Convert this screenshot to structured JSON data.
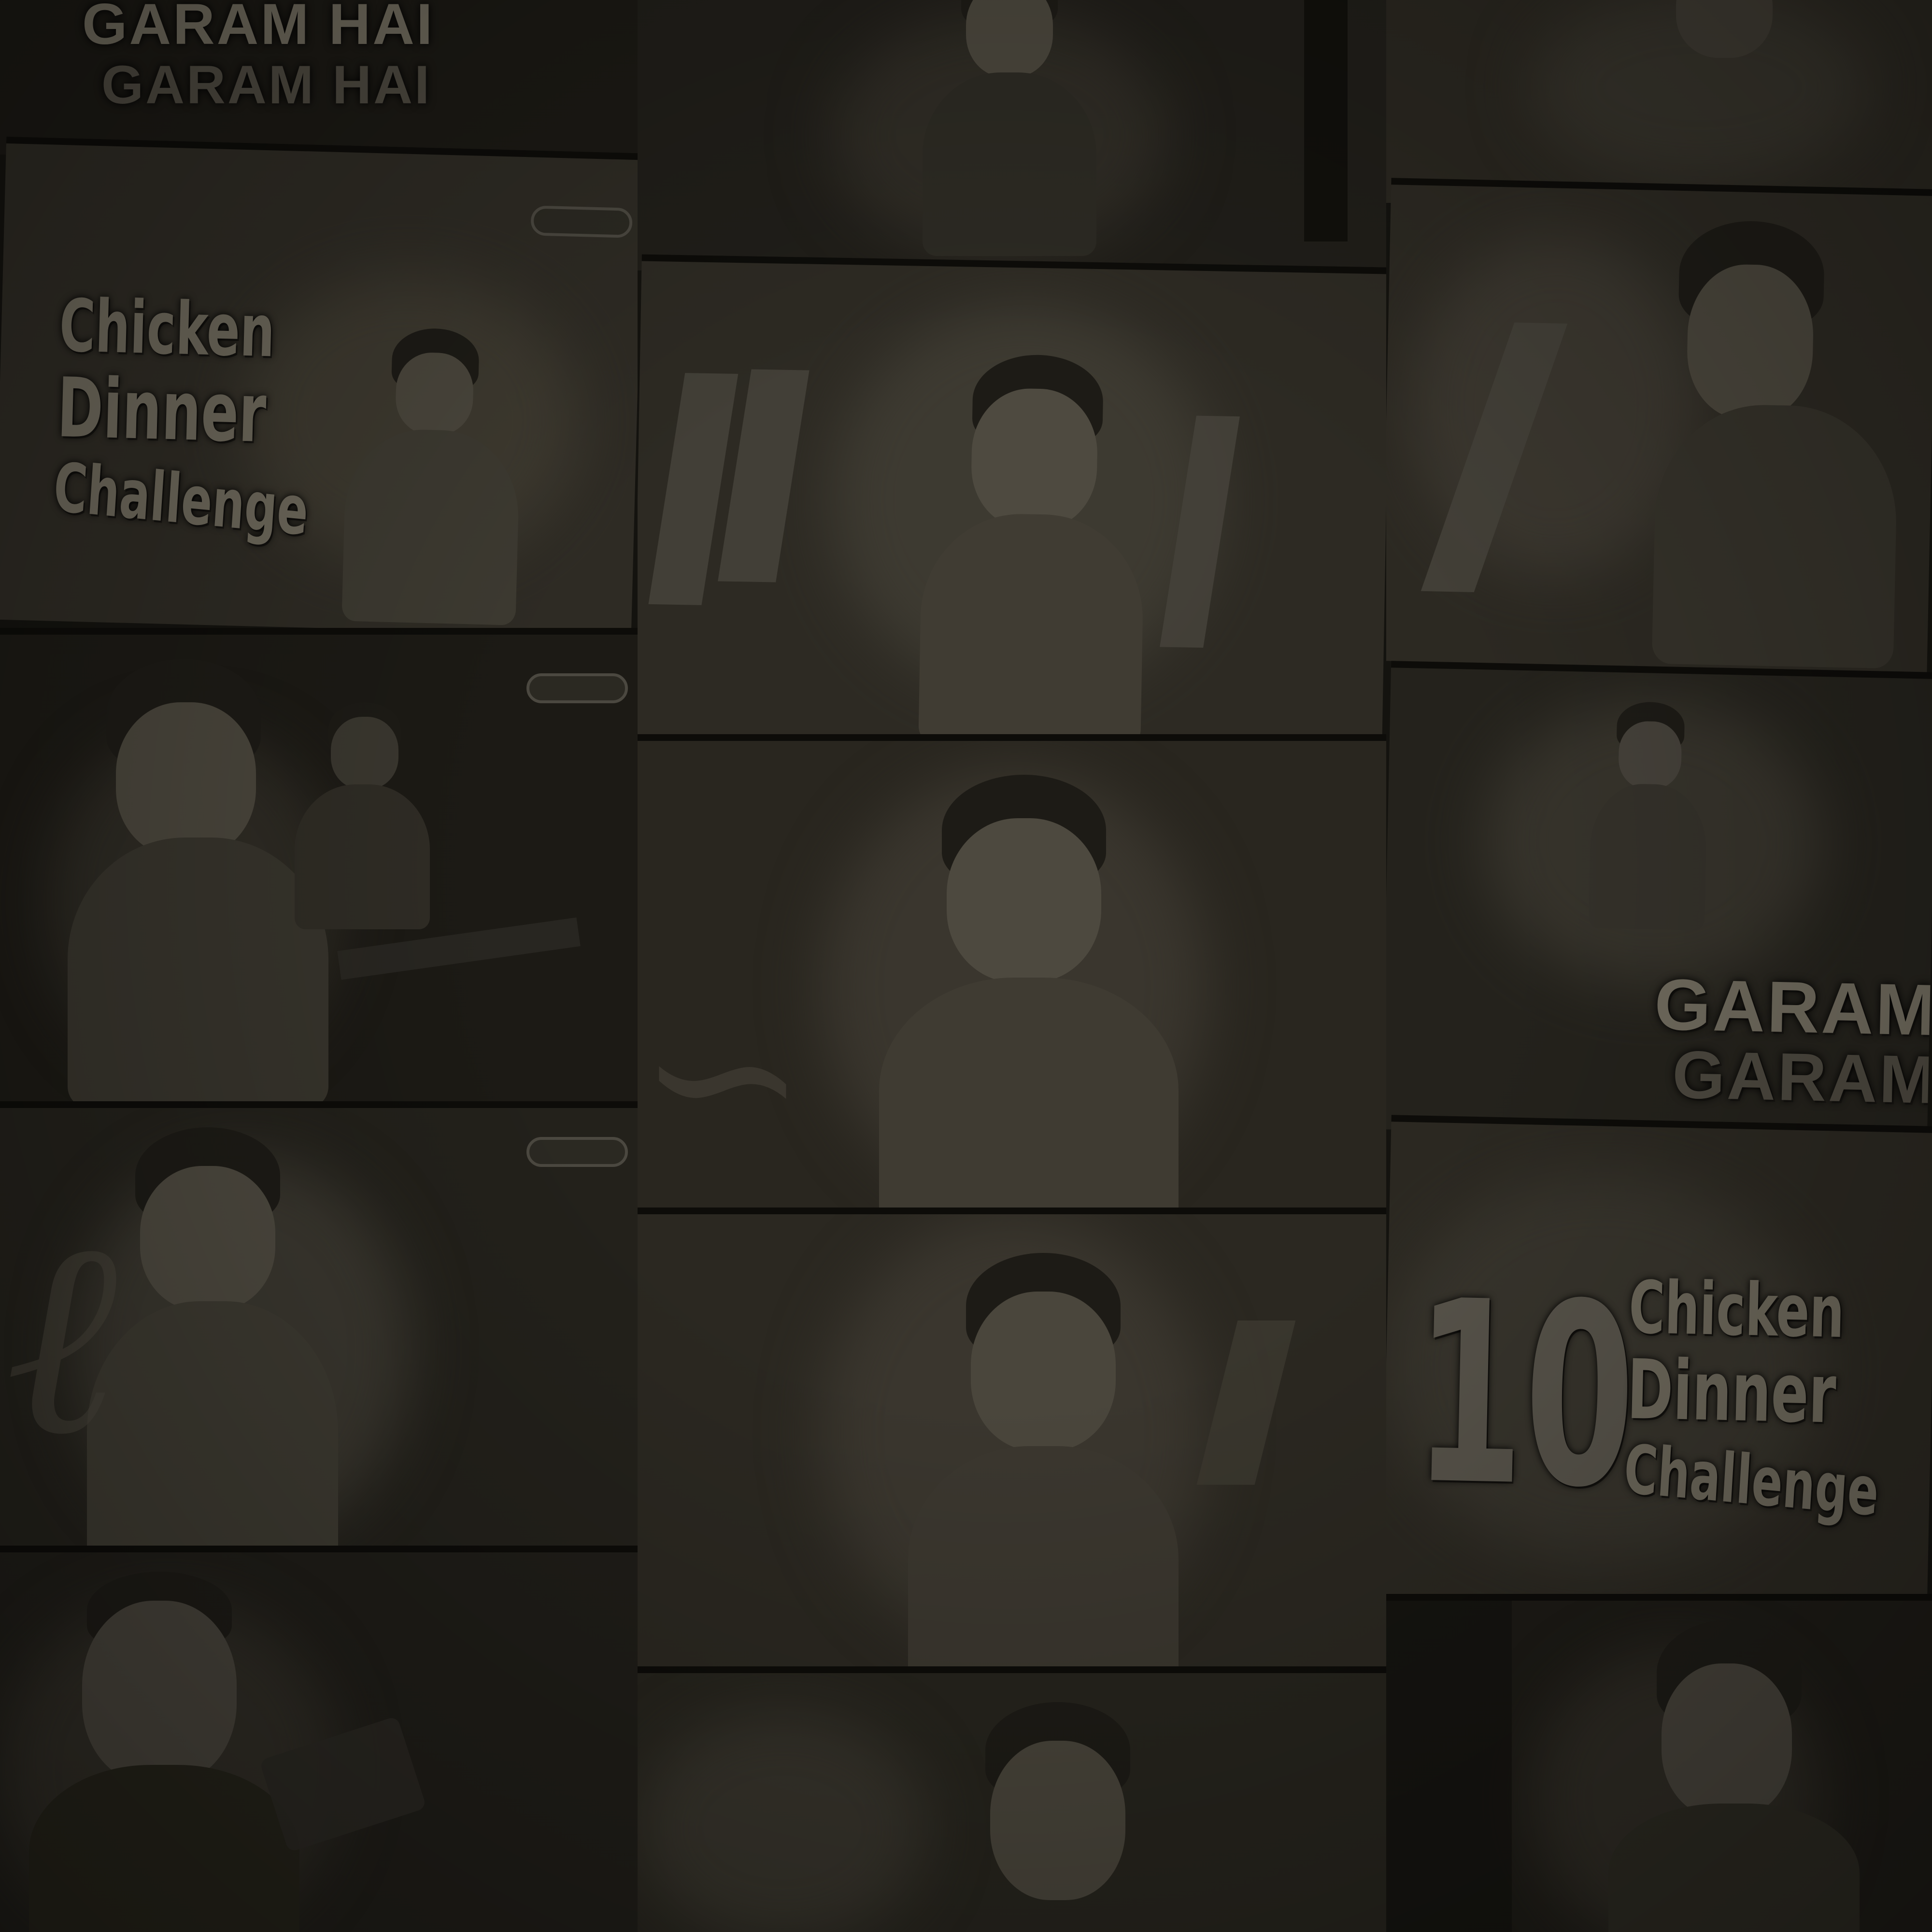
{
  "description_free": true,
  "colors": {
    "background": "#14130f",
    "tile_dark": "#1e1c17",
    "tile_mid": "#2f2c25",
    "tile_light": "#3a372f",
    "text": "#6d685b"
  },
  "thumbnails": {
    "left_top_title_line1": "GARAM HAI",
    "left_top_title_line2": "GARAM HAI",
    "left_chicken_line1": "Chicken",
    "left_chicken_line2": "Dinner",
    "left_chicken_line3": "Challenge",
    "right_garam_line1": "GARAM",
    "right_garam_line2": "GARAM",
    "right_number": "10",
    "right_chicken_line1": "Chicken",
    "right_chicken_line2": "Dinner",
    "right_chicken_line3": "Challenge"
  }
}
